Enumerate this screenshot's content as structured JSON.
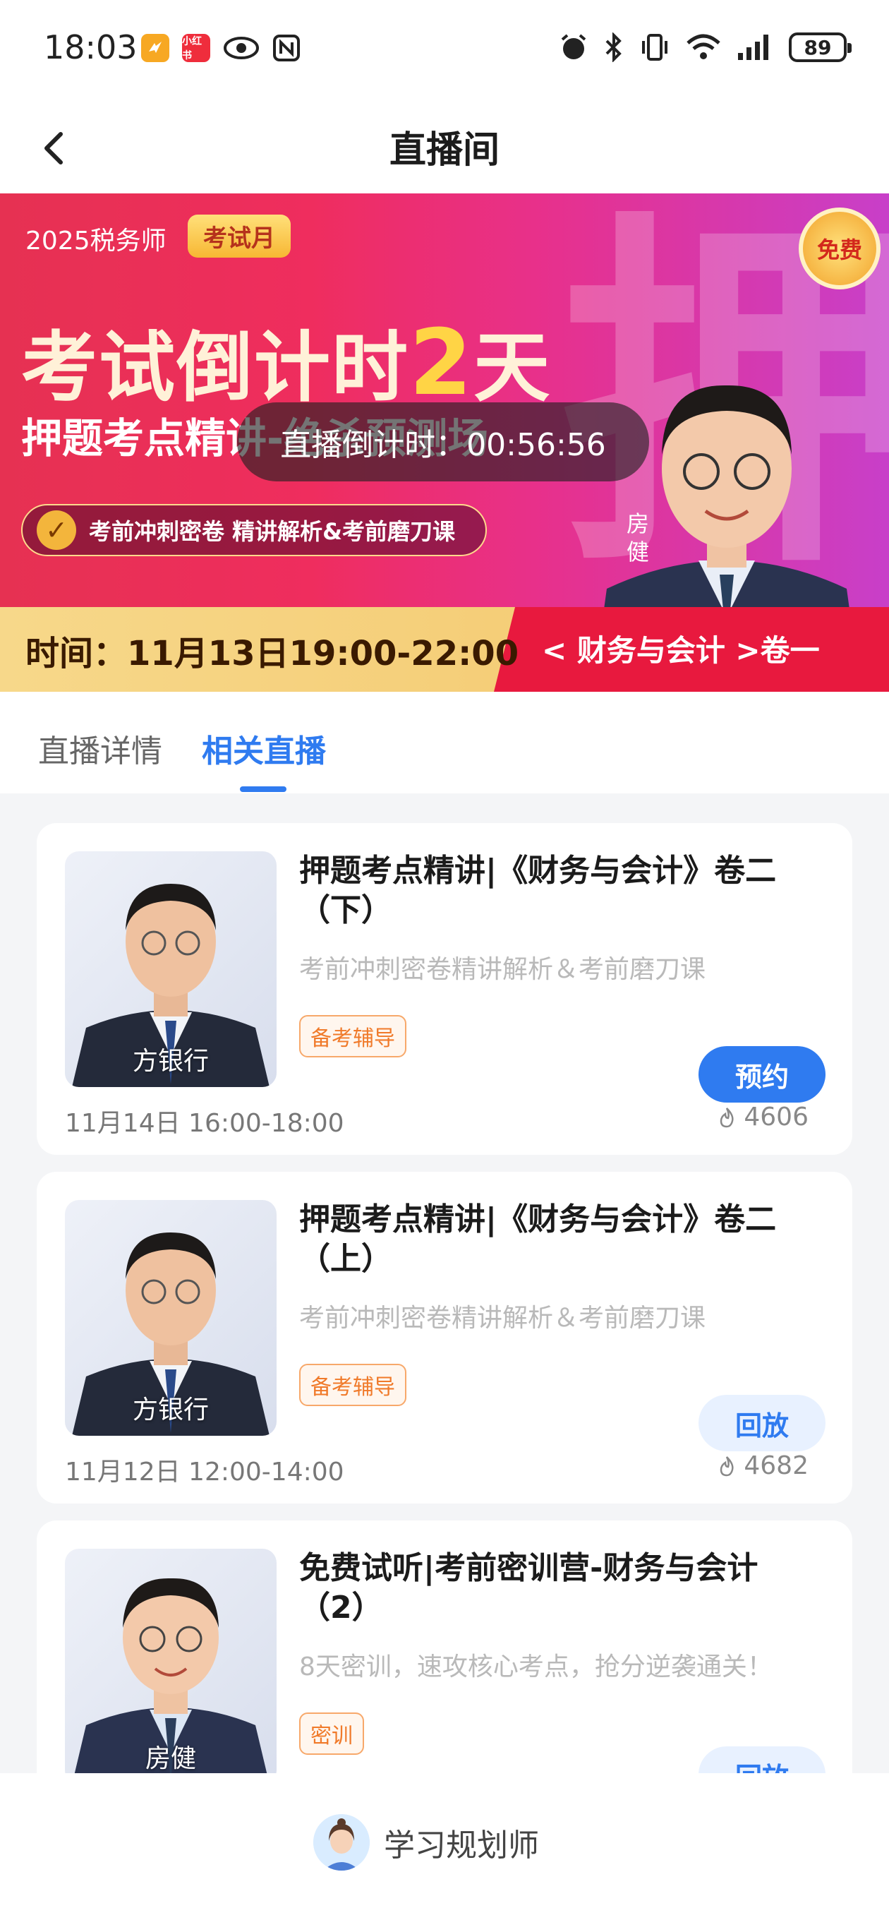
{
  "status_bar": {
    "time": "18:03",
    "battery": "89",
    "app_badges": [
      {
        "label": "",
        "color": "#f7a823"
      },
      {
        "label": "小红书",
        "color": "#ef2d3c"
      }
    ],
    "icons": [
      "eye-icon",
      "nfc-icon",
      "alarm-icon",
      "bluetooth-icon",
      "vibrate-icon",
      "wifi-icon",
      "signal-icon"
    ]
  },
  "nav": {
    "title": "直播间",
    "back_icon": "chevron-left-icon"
  },
  "banner": {
    "year_label": "2025税务师",
    "tag": "考试月",
    "free_badge": "免费",
    "headline_pre": "考试倒计时",
    "headline_num": "2",
    "headline_post": "天",
    "subtitle": "押题考点精讲-绝杀预测场",
    "big_char": "押",
    "pill_text": "考前冲刺密卷  精讲解析&考前磨刀课",
    "teacher_name": "房健",
    "time": "时间：11月13日19:00-22:00",
    "course": "< 财务与会计 >卷一",
    "countdown": "直播倒计时：00:56:56"
  },
  "tabs": [
    {
      "label": "直播详情",
      "active": false
    },
    {
      "label": "相关直播",
      "active": true
    }
  ],
  "cards": [
    {
      "title": "押题考点精讲|《财务与会计》卷二（下）",
      "desc": "考前冲刺密卷精讲解析＆考前磨刀课",
      "tag": "备考辅导",
      "teacher": "方银行",
      "date": "11月14日 16:00-18:00",
      "views": "4606",
      "button": "预约",
      "button_style": "primary"
    },
    {
      "title": "押题考点精讲|《财务与会计》卷二（上）",
      "desc": "考前冲刺密卷精讲解析＆考前磨刀课",
      "tag": "备考辅导",
      "teacher": "方银行",
      "date": "11月12日 12:00-14:00",
      "views": "4682",
      "button": "回放",
      "button_style": "ghost"
    },
    {
      "title": "免费试听|考前密训营-财务与会计（2）",
      "desc": "8天密训，速攻核心考点，抢分逆袭通关！",
      "tag": "密训",
      "teacher": "房健",
      "button": "回放",
      "button_style": "ghost"
    }
  ],
  "bottom": {
    "advisor_label": "学习规划师"
  },
  "colors": {
    "accent": "#2f7bf0",
    "tag_orange": "#f07a2a",
    "banner_red": "#e8193e"
  }
}
